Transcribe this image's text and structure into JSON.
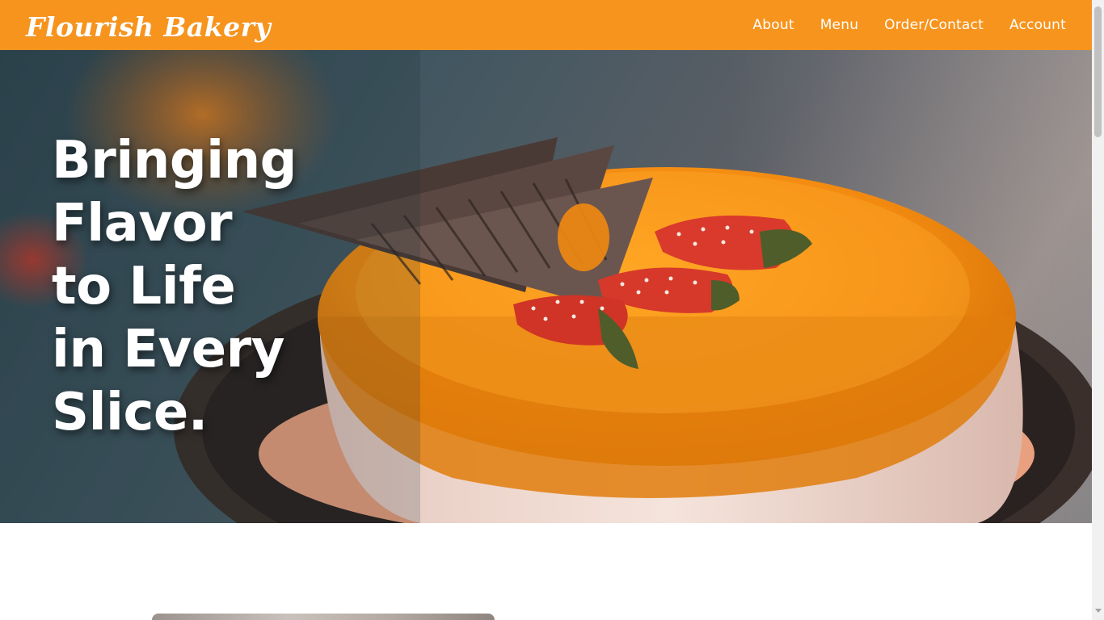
{
  "brand": {
    "name": "Flourish Bakery",
    "color": "#f7941d"
  },
  "nav": {
    "items": [
      {
        "label": "About"
      },
      {
        "label": "Menu"
      },
      {
        "label": "Order/Contact"
      },
      {
        "label": "Account"
      }
    ]
  },
  "hero": {
    "title_lines": [
      "Bringing",
      "Flavor",
      "to Life",
      "in Every",
      "Slice."
    ],
    "image": "orange-glazed-cake-with-strawberries-and-chocolate-shards"
  },
  "colors": {
    "accent": "#f7941d",
    "text_on_accent": "#ffffff"
  }
}
